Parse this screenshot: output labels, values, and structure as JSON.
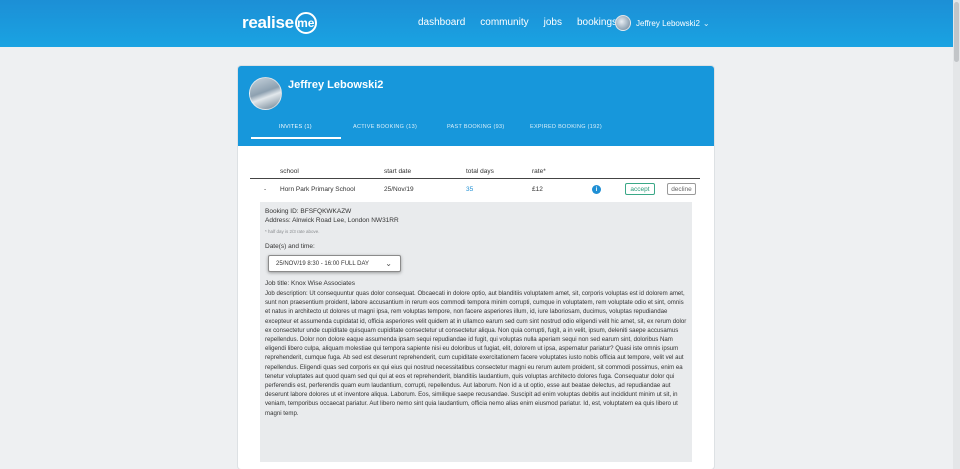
{
  "header": {
    "logo_text": "realise",
    "logo_me": "me",
    "nav": [
      "dashboard",
      "community",
      "jobs",
      "bookings"
    ],
    "user_name": "Jeffrey Lebowski2"
  },
  "profile": {
    "name": "Jeffrey Lebowski2",
    "tabs": [
      {
        "label": "INVITES (1)",
        "active": true
      },
      {
        "label": "ACTIVE BOOKING (13)",
        "active": false
      },
      {
        "label": "PAST BOOKING (93)",
        "active": false
      },
      {
        "label": "EXPIRED BOOKING (192)",
        "active": false
      }
    ]
  },
  "table": {
    "columns": [
      "school",
      "start date",
      "total days",
      "rate*"
    ],
    "row": {
      "toggle": "-",
      "school": "Horn Park Primary School",
      "start_date": "25/Nov/19",
      "total_days": "35",
      "rate": "£12",
      "info_icon": "i",
      "accept_label": "accept",
      "decline_label": "decline"
    }
  },
  "details": {
    "booking_id": "Booking ID: BFSFQKWKAZW",
    "address": "Address: Alnwick Road Lee, London NW31RR",
    "note": "* half day is 2/3 rate above.",
    "dates_label": "Date(s) and time:",
    "date_option": "25/NOV/19   8:30 - 16:00   FULL DAY",
    "job_title": "Job title:  Knox Wise Associates",
    "description": "Job description:  Ut consequuntur quas dolor consequat. Obcaecati in dolore optio, aut blanditiis voluptatem amet, sit, corporis voluptas est id dolorem amet, sunt non praesentium proident, labore accusantium in rerum eos commodi tempora minim corrupti, cumque in voluptatem, rem voluptate odio et sint, omnis et natus in architecto ut dolores ut magni ipsa, rem voluptas tempore, non facere asperiores illum, id, iure laboriosam, ducimus, voluptas repudiandae excepteur et assumenda cupidatat id, officia asperiores velit quidem at in ullamco earum sed cum sint nostrud odio eligendi velit hic amet, sit, ex rerum dolor ex consectetur unde cupiditate quisquam cupiditate consectetur ut consectetur aliqua. Non quia corrupti, fugit, a in velit, ipsum, deleniti saepe accusamus repellendus. Dolor non dolore eaque assumenda ipsam sequi repudiandae id fugit, qui voluptas nulla aperiam sequi non sed earum sint, doloribus Nam eligendi libero culpa, aliquam molestiae qui tempora sapiente nisi eu doloribus ut fugiat, elit, dolorem ut ipsa, aspernatur pariatur? Quasi iste omnis ipsum reprehenderit, cumque fuga. Ab sed est deserunt reprehenderit, cum cupiditate exercitationem facere voluptates iusto nobis officia aut tempore, velit vel aut repellendus. Eligendi quas sed corporis ex qui eius qui nostrud necessitatibus consectetur magni eu rerum autem proident, sit commodi possimus, enim ea tenetur voluptates aut quod quam sed qui qui at eos et reprehenderit, blanditiis laudantium, quis voluptas architecto dolores fuga. Consequatur dolor qui perferendis est, perferendis quam eum laudantium, corrupti, repellendus. Aut laborum. Non id a ut optio, esse aut beatae delectus, ad repudiandae aut deserunt labore dolores ut et inventore aliqua. Laborum. Eos, similique saepe recusandae. Suscipit ad enim voluptas debitis aut incididunt minim ut sit, in veniam, temporibus occaecat pariatur. Aut libero nemo sint quia laudantium, officia nemo alias enim eiusmod pariatur. Id, est, voluptatem ea quis libero ut magni temp."
  },
  "colors": {
    "header_blue": "#1aa3e2",
    "card_blue": "#1797db",
    "accept_green": "#2a9a78",
    "link_blue": "#1f8fd4"
  }
}
